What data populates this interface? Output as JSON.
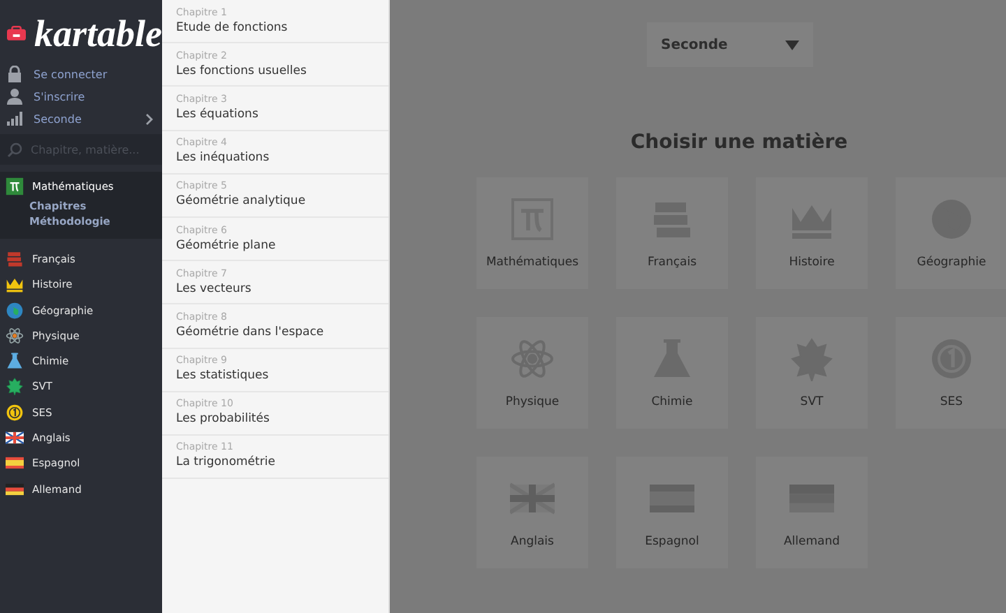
{
  "logo": {
    "text": "kartable"
  },
  "account_links": [
    {
      "label": "Se connecter",
      "kind": "lock"
    },
    {
      "label": "S'inscrire",
      "kind": "user"
    }
  ],
  "level_selector": {
    "label": "Seconde"
  },
  "search": {
    "placeholder": "Chapitre, matière..."
  },
  "subjects": [
    {
      "label": "Mathématiques",
      "kind": "math",
      "selected": true,
      "children": [
        {
          "label": "Chapitres"
        },
        {
          "label": "Méthodologie"
        }
      ]
    },
    {
      "label": "Français",
      "kind": "french",
      "selected": false
    },
    {
      "label": "Histoire",
      "kind": "history",
      "selected": false
    },
    {
      "label": "Géographie",
      "kind": "geography",
      "selected": false
    },
    {
      "label": "Physique",
      "kind": "physics",
      "selected": false
    },
    {
      "label": "Chimie",
      "kind": "chemistry",
      "selected": false
    },
    {
      "label": "SVT",
      "kind": "svt",
      "selected": false
    },
    {
      "label": "SES",
      "kind": "ses",
      "selected": false
    },
    {
      "label": "Anglais",
      "kind": "english",
      "selected": false
    },
    {
      "label": "Espagnol",
      "kind": "spanish",
      "selected": false
    },
    {
      "label": "Allemand",
      "kind": "german",
      "selected": false
    }
  ],
  "chapters": [
    {
      "number": "Chapitre 1",
      "title": "Etude de fonctions"
    },
    {
      "number": "Chapitre 2",
      "title": "Les fonctions usuelles"
    },
    {
      "number": "Chapitre 3",
      "title": "Les équations"
    },
    {
      "number": "Chapitre 4",
      "title": "Les inéquations"
    },
    {
      "number": "Chapitre 5",
      "title": "Géométrie analytique"
    },
    {
      "number": "Chapitre 6",
      "title": "Géométrie plane"
    },
    {
      "number": "Chapitre 7",
      "title": "Les vecteurs"
    },
    {
      "number": "Chapitre 8",
      "title": "Géométrie dans l'espace"
    },
    {
      "number": "Chapitre 9",
      "title": "Les statistiques"
    },
    {
      "number": "Chapitre 10",
      "title": "Les probabilités"
    },
    {
      "number": "Chapitre 11",
      "title": "La trigonométrie"
    }
  ],
  "main": {
    "level_dropdown": "Seconde",
    "heading": "Choisir une matière",
    "tiles": [
      {
        "label": "Mathématiques",
        "kind": "math"
      },
      {
        "label": "Français",
        "kind": "french"
      },
      {
        "label": "Histoire",
        "kind": "history"
      },
      {
        "label": "Géographie",
        "kind": "geography"
      },
      {
        "label": "Physique",
        "kind": "physics"
      },
      {
        "label": "Chimie",
        "kind": "chemistry"
      },
      {
        "label": "SVT",
        "kind": "svt"
      },
      {
        "label": "SES",
        "kind": "ses"
      },
      {
        "label": "Anglais",
        "kind": "english"
      },
      {
        "label": "Espagnol",
        "kind": "spanish"
      },
      {
        "label": "Allemand",
        "kind": "german"
      }
    ]
  }
}
